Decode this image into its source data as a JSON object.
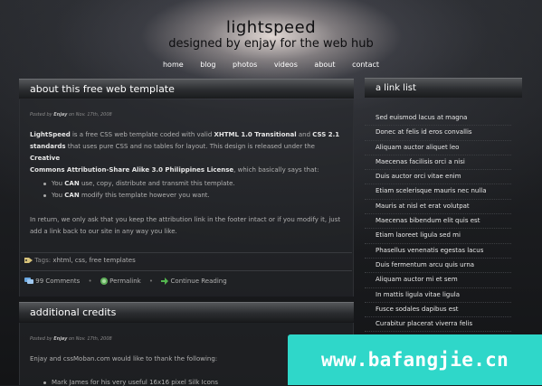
{
  "header": {
    "title": "lightspeed",
    "tagline": "designed by enjay for the web hub"
  },
  "nav": [
    "home",
    "blog",
    "photos",
    "videos",
    "about",
    "contact"
  ],
  "post1": {
    "title": "about this free web template",
    "meta_prefix": "Posted by",
    "meta_author": "Enjay",
    "meta_suffix": "on Nov. 17th, 2008",
    "p1_brand": "LightSpeed",
    "p1_a": " is a free CSS web template coded with valid ",
    "p1_xhtml": "XHTML 1.0 Transitional",
    "p1_b": " and ",
    "p1_css": "CSS 2.1",
    "p1_standards": "standards",
    "p1_c": " that uses pure CSS and no tables for layout. This design is released under the ",
    "p1_license": "Creative",
    "p1_license2": "Commons Attribution-Share Alike 3.0 Philippines License",
    "p1_d": ", which basically says that:",
    "b1_pre": "You ",
    "b1_can": "CAN",
    "b1_post": " use, copy, distribute and transmit this template.",
    "b2_pre": "You ",
    "b2_can": "CAN",
    "b2_post": " modify this template however you want.",
    "p2_line1": "In return, we only ask that you keep the attribution link in the footer intact or if you modify it, just",
    "p2_line2": "add a link back to our site in any way you like.",
    "tags_label": "Tags:",
    "tags": "xhtml, css, free templates",
    "comments": "99 Comments",
    "permalink": "Permalink",
    "continue": "Continue Reading"
  },
  "post2": {
    "title": "additional credits",
    "meta_prefix": "Posted by",
    "meta_author": "Enjay",
    "meta_suffix": "on Nov. 17th, 2008",
    "p1": "Enjay and cssMoban.com would like to thank the following:",
    "b1": "Mark James for his very useful 16x16 pixel Silk Icons"
  },
  "sidebar": {
    "title": "a link list",
    "links": [
      "Sed euismod lacus at magna",
      "Donec at felis id eros convallis",
      "Aliquam auctor aliquet leo",
      "Maecenas facilisis orci a nisi",
      "Duis auctor orci vitae enim",
      "Etiam scelerisque mauris nec nulla",
      "Mauris at nisl et erat volutpat",
      "Maecenas bibendum elit quis est",
      "Etiam laoreet ligula sed mi",
      "Phasellus venenatis egestas lacus",
      "Duis fermentum arcu quis urna",
      "Aliquam auctor mi et sem",
      "In mattis ligula vitae ligula",
      "Fusce sodales dapibus est",
      "Curabitur placerat viverra felis"
    ]
  },
  "watermark": "www.bafangjie.cn"
}
